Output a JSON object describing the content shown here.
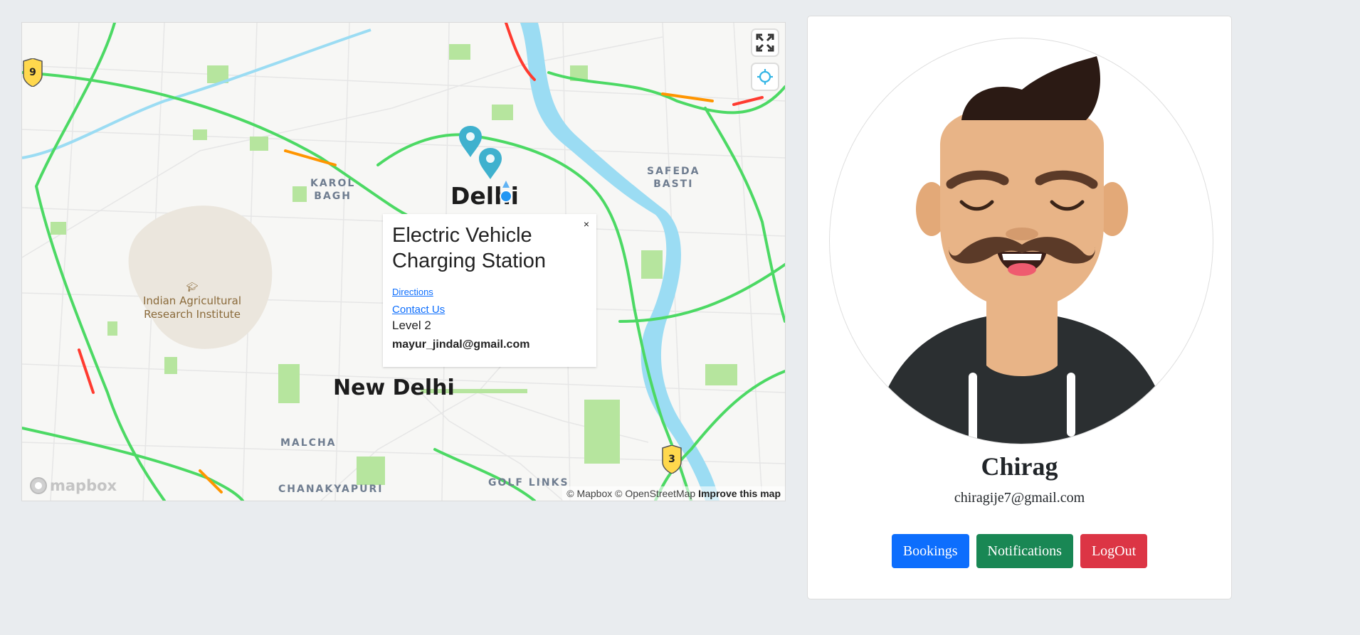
{
  "map": {
    "labels": {
      "karol_bagh": [
        "KAROL",
        "BAGH"
      ],
      "safeda_basti": [
        "SAFEDA",
        "BASTI"
      ],
      "delhi": "Delhi",
      "new_delhi": "New Delhi",
      "iari": [
        "Indian Agricultural",
        "Research Institute"
      ],
      "malcha": "MALCHA",
      "chanakyapuri": "CHANAKYAPURI",
      "golf_links": "GOLF LINKS",
      "highway_9": "9",
      "highway_3": "3"
    },
    "logo": "mapbox",
    "attribution": {
      "text": "© Mapbox © OpenStreetMap",
      "improve": "Improve this map"
    },
    "colors": {
      "marker": "#3fb1ce",
      "traffic_green": "#4cd964",
      "traffic_orange": "#ff9500",
      "traffic_red": "#ff3b30",
      "river": "#9bdcf3",
      "park": "#b6e59e",
      "highway_shield": "#ffd84d"
    },
    "popup": {
      "close": "×",
      "title": "Electric Vehicle Charging Station",
      "directions": "Directions",
      "contact": "Contact Us",
      "level": "Level 2",
      "email": "mayur_jindal@gmail.com"
    }
  },
  "profile": {
    "name": "Chirag",
    "email": "chiragije7@gmail.com",
    "buttons": {
      "bookings": "Bookings",
      "notifications": "Notifications",
      "logout": "LogOut"
    },
    "colors": {
      "bookings": "#0d6efd",
      "notifications": "#198754",
      "logout": "#dc3545"
    }
  }
}
